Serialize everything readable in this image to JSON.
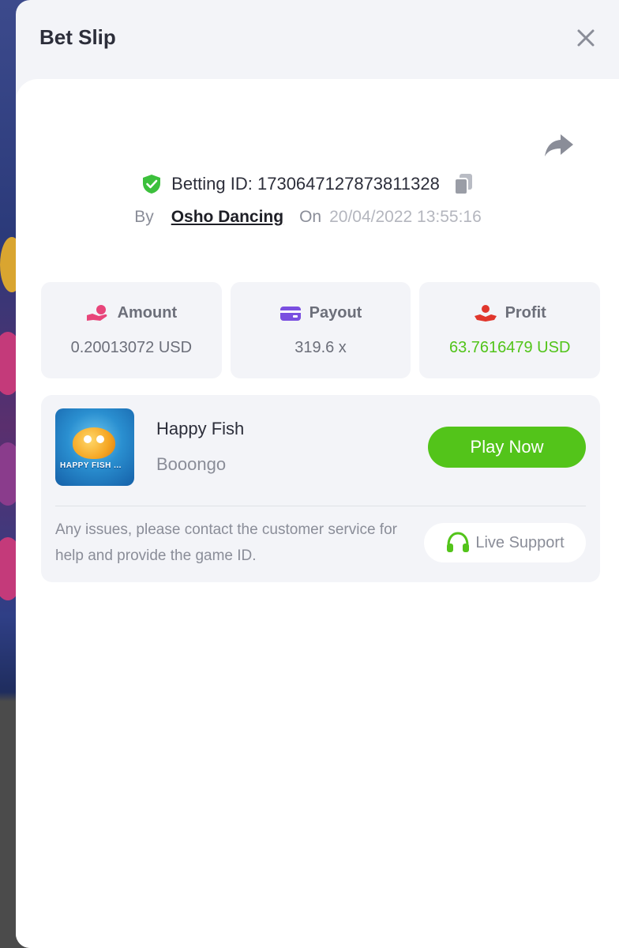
{
  "modal": {
    "title": "Bet Slip"
  },
  "bet": {
    "id_label": "Betting ID: 1730647127873811328",
    "by_label": "By",
    "user": "Osho Dancing",
    "on_label": "On",
    "date": "20/04/2022 13:55:16"
  },
  "stats": {
    "amount": {
      "label": "Amount",
      "value": "0.20013072 USD"
    },
    "payout": {
      "label": "Payout",
      "value": "319.6 x"
    },
    "profit": {
      "label": "Profit",
      "value": "63.7616479 USD"
    }
  },
  "game": {
    "name": "Happy Fish",
    "provider": "Booongo",
    "thumbnail_text": "HAPPY FISH ...",
    "play_label": "Play Now"
  },
  "support": {
    "message": "Any issues, please contact the customer service for help and provide the game ID.",
    "button_label": "Live Support"
  },
  "colors": {
    "accent_green": "#53c41a",
    "profit_green": "#52c41a",
    "amount_icon": "#e8457a",
    "payout_icon": "#7a4fe0",
    "profit_icon": "#e0362c"
  },
  "icons": {
    "close": "close-icon",
    "share": "share-icon",
    "shield": "shield-check-icon",
    "copy": "copy-icon",
    "amount": "hand-coin-icon",
    "payout": "wallet-icon",
    "profit": "hand-heart-icon",
    "support": "headset-icon"
  }
}
